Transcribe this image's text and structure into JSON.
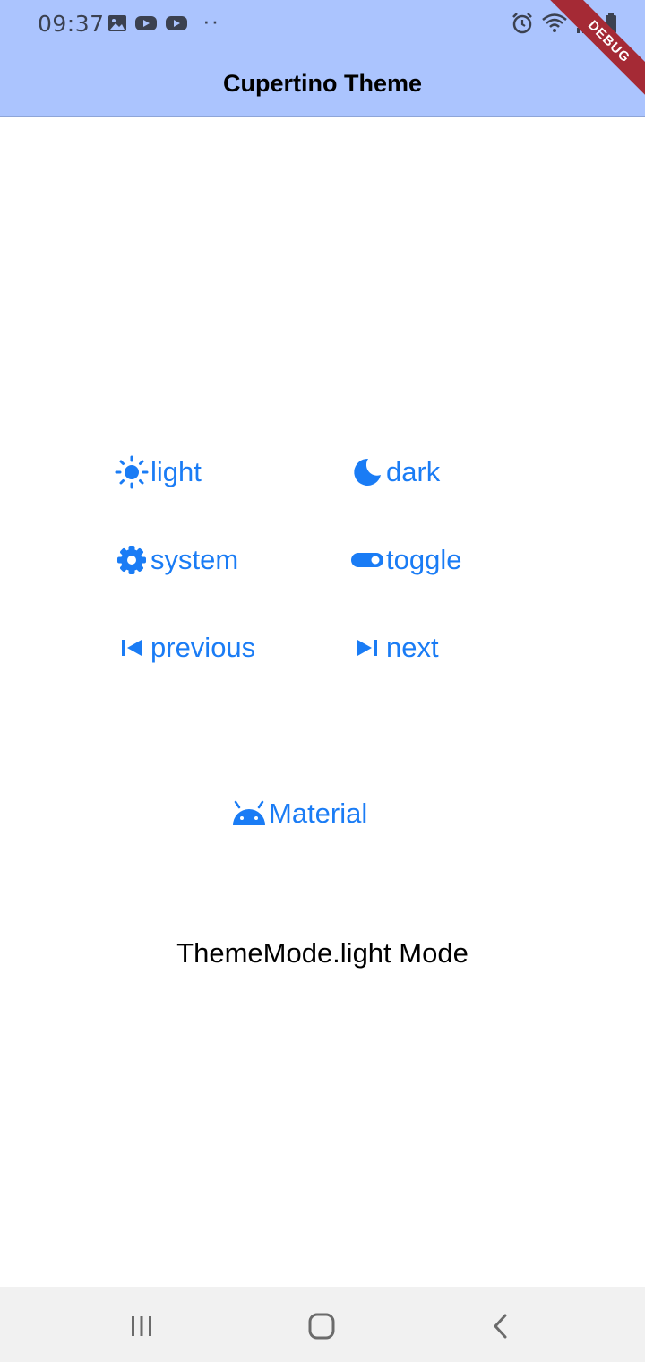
{
  "status_bar": {
    "time": "09:37",
    "left_icons": [
      "image-icon",
      "youtube-icon",
      "youtube-icon"
    ],
    "more": "··",
    "right_icons": [
      "alarm-icon",
      "wifi-icon",
      "signal-icon",
      "battery-icon"
    ]
  },
  "app_bar": {
    "title": "Cupertino Theme"
  },
  "debug_banner": "DEBUG",
  "buttons": {
    "light": {
      "label": "light",
      "icon": "sun-icon"
    },
    "dark": {
      "label": "dark",
      "icon": "moon-icon"
    },
    "system": {
      "label": "system",
      "icon": "gear-icon"
    },
    "toggle": {
      "label": "toggle",
      "icon": "toggle-icon"
    },
    "previous": {
      "label": "previous",
      "icon": "skip-previous-icon"
    },
    "next": {
      "label": "next",
      "icon": "skip-next-icon"
    },
    "material": {
      "label": "Material",
      "icon": "android-icon"
    }
  },
  "mode_text": "ThemeMode.light Mode",
  "nav_bar": {
    "recents": "recents-icon",
    "home": "home-icon",
    "back": "back-icon"
  },
  "colors": {
    "app_bar": "#abc4fe",
    "accent": "#1a7cf5",
    "debug_banner": "#a52a35",
    "nav_bar": "#f1f1f1"
  }
}
